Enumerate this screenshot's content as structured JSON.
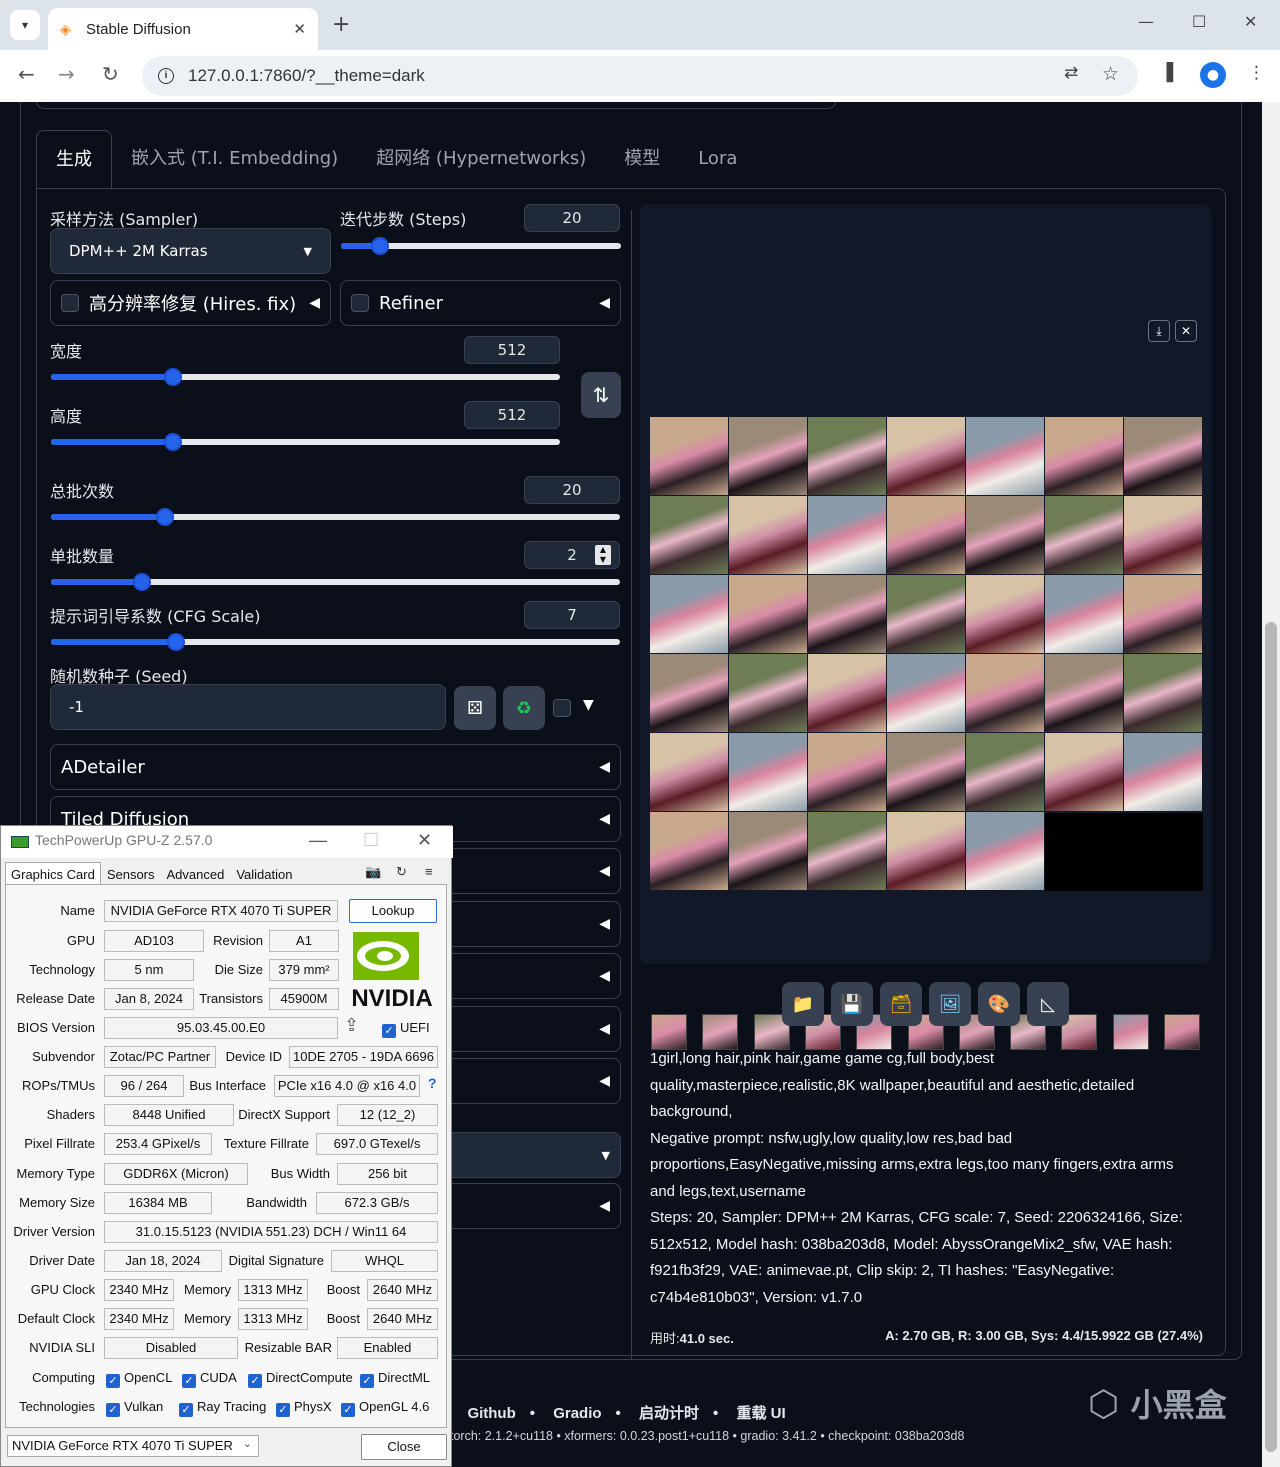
{
  "browser": {
    "tab_title": "Stable Diffusion",
    "url": "127.0.0.1:7860/?__theme=dark"
  },
  "tabs": [
    "生成",
    "嵌入式 (T.I. Embedding)",
    "超网络 (Hypernetworks)",
    "模型",
    "Lora"
  ],
  "sampler": {
    "label": "采样方法 (Sampler)",
    "value": "DPM++ 2M Karras"
  },
  "steps": {
    "label": "迭代步数 (Steps)",
    "value": "20",
    "fraction": 0.14
  },
  "hires": {
    "label": "高分辨率修复 (Hires. fix)"
  },
  "refiner": {
    "label": "Refiner"
  },
  "width": {
    "label": "宽度",
    "value": "512",
    "fraction": 0.24
  },
  "height": {
    "label": "高度",
    "value": "512",
    "fraction": 0.24
  },
  "batch_count": {
    "label": "总批次数",
    "value": "20",
    "fraction": 0.2
  },
  "batch_size": {
    "label": "单批数量",
    "value": "2",
    "fraction": 0.16
  },
  "cfg": {
    "label": "提示词引导系数 (CFG Scale)",
    "value": "7",
    "fraction": 0.22
  },
  "seed": {
    "label": "随机数种子 (Seed)",
    "value": "-1"
  },
  "accordions": [
    "ADetailer",
    "Tiled Diffusion"
  ],
  "info": {
    "prompt": "1girl,long hair,pink hair,game game cg,full body,best quality,masterpiece,realistic,8K wallpaper,beautiful and aesthetic,detailed background,",
    "negative": "Negative prompt: nsfw,ugly,low quality,low res,bad bad proportions,EasyNegative,missing arms,extra legs,too many fingers,extra arms and legs,text,username",
    "params": "Steps: 20, Sampler: DPM++ 2M Karras, CFG scale: 7, Seed: 2206324166, Size: 512x512, Model hash: 038ba203d8, Model: AbyssOrangeMix2_sfw, VAE hash: f921fb3f29, VAE: animevae.pt, Clip skip: 2, TI hashes: \"EasyNegative: c74b4e810b03\", Version: v1.7.0"
  },
  "timing": {
    "label": "用时:",
    "time": "41.0 sec.",
    "vram": "A: 2.70 GB, R: 3.00 GB, Sys: 4.4/15.9922 GB (27.4%)"
  },
  "footer": {
    "links": [
      "Github",
      "Gradio",
      "启动计时",
      "重载 UI"
    ],
    "versions": "torch: 2.1.2+cu118  •  xformers: 0.0.23.post1+cu118  •  gradio: 3.41.2  •  checkpoint: 038ba203d8"
  },
  "watermark": "小黑盒",
  "gpuz": {
    "title": "TechPowerUp GPU-Z 2.57.0",
    "tabs": [
      "Graphics Card",
      "Sensors",
      "Advanced",
      "Validation"
    ],
    "lookup": "Lookup",
    "name_label": "Name",
    "name": "NVIDIA GeForce RTX 4070 Ti SUPER",
    "gpu_label": "GPU",
    "gpu": "AD103",
    "revision_label": "Revision",
    "revision": "A1",
    "tech_label": "Technology",
    "tech": "5 nm",
    "die_label": "Die Size",
    "die": "379 mm²",
    "release_label": "Release Date",
    "release": "Jan 8, 2024",
    "transistors_label": "Transistors",
    "transistors": "45900M",
    "bios_label": "BIOS Version",
    "bios": "95.03.45.00.E0",
    "uefi": "UEFI",
    "subvendor_label": "Subvendor",
    "subvendor": "Zotac/PC Partner",
    "device_label": "Device ID",
    "device": "10DE 2705 - 19DA 6696",
    "rops_label": "ROPs/TMUs",
    "rops": "96 / 264",
    "bus_label": "Bus Interface",
    "bus": "PCIe x16 4.0 @ x16 4.0",
    "shaders_label": "Shaders",
    "shaders": "8448 Unified",
    "dx_label": "DirectX Support",
    "dx": "12 (12_2)",
    "pix_label": "Pixel Fillrate",
    "pix": "253.4 GPixel/s",
    "tex_label": "Texture Fillrate",
    "tex": "697.0 GTexel/s",
    "memtype_label": "Memory Type",
    "memtype": "GDDR6X (Micron)",
    "buswidth_label": "Bus Width",
    "buswidth": "256 bit",
    "memsize_label": "Memory Size",
    "memsize": "16384 MB",
    "bw_label": "Bandwidth",
    "bw": "672.3 GB/s",
    "driver_label": "Driver Version",
    "driver": "31.0.15.5123 (NVIDIA 551.23) DCH / Win11 64",
    "driverdate_label": "Driver Date",
    "driverdate": "Jan 18, 2024",
    "sig_label": "Digital Signature",
    "sig": "WHQL",
    "gpuclock_label": "GPU Clock",
    "gpuclock": "2340 MHz",
    "mem_label": "Memory",
    "memclock": "1313 MHz",
    "boost_label": "Boost",
    "boost": "2640 MHz",
    "defclock_label": "Default Clock",
    "defclock": "2340 MHz",
    "defmem": "1313 MHz",
    "defboost": "2640 MHz",
    "sli_label": "NVIDIA SLI",
    "sli": "Disabled",
    "rebar_label": "Resizable BAR",
    "rebar": "Enabled",
    "computing_label": "Computing",
    "computing": [
      "OpenCL",
      "CUDA",
      "DirectCompute",
      "DirectML"
    ],
    "tech2_label": "Technologies",
    "technologies": [
      "Vulkan",
      "Ray Tracing",
      "PhysX",
      "OpenGL 4.6"
    ],
    "selected": "NVIDIA GeForce RTX 4070 Ti SUPER",
    "close": "Close",
    "nvidia": "NVIDIA"
  }
}
